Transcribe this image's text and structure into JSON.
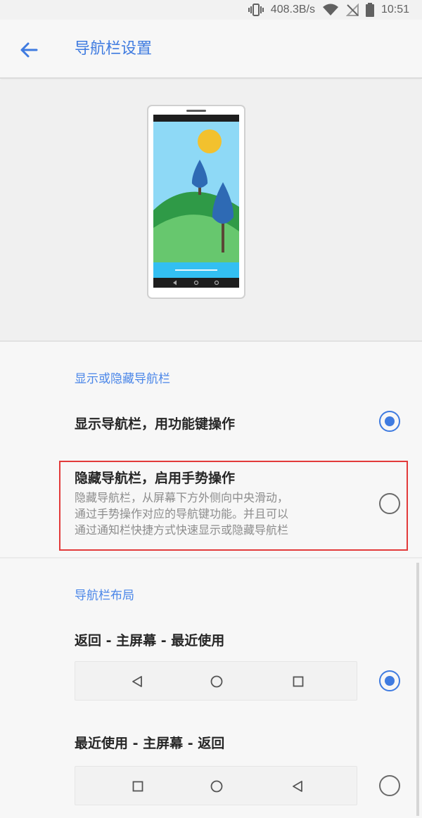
{
  "status_bar": {
    "net_speed": "408.3B/s",
    "time": "10:51"
  },
  "app_bar": {
    "title": "导航栏设置"
  },
  "section_visibility": {
    "header": "显示或隐藏导航栏",
    "options": [
      {
        "title": "显示导航栏，用功能键操作",
        "selected": true
      },
      {
        "title": "隐藏导航栏，启用手势操作",
        "description": [
          "隐藏导航栏，从屏幕下方外侧向中央滑动，",
          "通过手势操作对应的导航键功能。并且可以",
          "通过通知栏快捷方式快速显示或隐藏导航栏"
        ],
        "selected": false
      }
    ]
  },
  "section_layout": {
    "header": "导航栏布局",
    "options": [
      {
        "title": "返回 - 主屏幕 - 最近使用",
        "buttons": [
          "back",
          "home",
          "recents"
        ],
        "selected": true
      },
      {
        "title": "最近使用 - 主屏幕 - 返回",
        "buttons": [
          "recents",
          "home",
          "back"
        ],
        "selected": false
      }
    ]
  },
  "colors": {
    "accent": "#3f7be0",
    "highlight": "#e23a3a"
  }
}
